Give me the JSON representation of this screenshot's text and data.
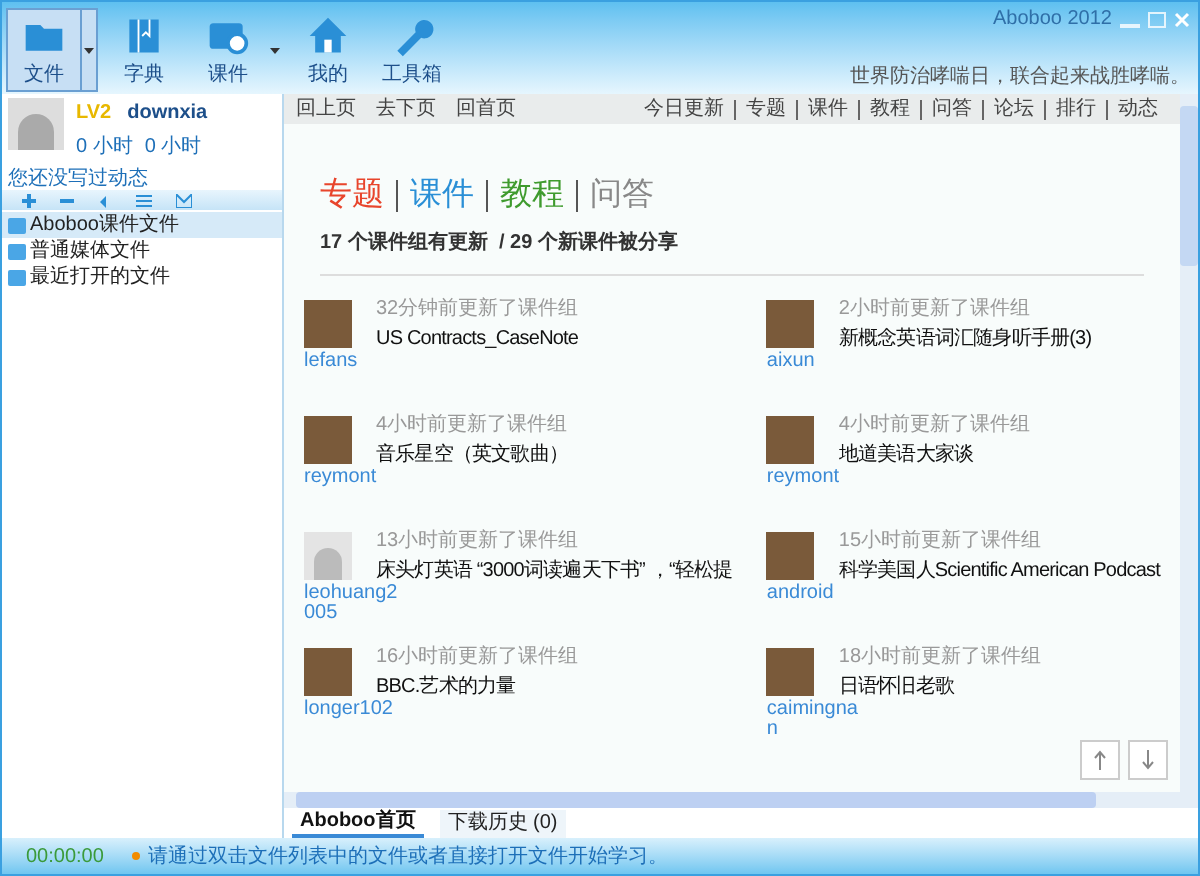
{
  "window": {
    "title": "Aboboo 2012"
  },
  "toolbar": [
    {
      "label": "文件",
      "selected": true,
      "dropdown": true,
      "kind": "folder"
    },
    {
      "label": "字典",
      "selected": false,
      "dropdown": false,
      "kind": "book"
    },
    {
      "label": "课件",
      "selected": false,
      "dropdown": true,
      "kind": "disc"
    },
    {
      "label": "我的",
      "selected": false,
      "dropdown": false,
      "kind": "home"
    },
    {
      "label": "工具箱",
      "selected": false,
      "dropdown": false,
      "kind": "wrench"
    }
  ],
  "notice": "世界防治哮喘日，联合起来战胜哮喘。",
  "user": {
    "level": "LV2",
    "name": "downxia",
    "listen_time": "0 小时",
    "speak_time": "0 小时",
    "status": "您还没写过动态"
  },
  "file_tree": [
    {
      "label": "Aboboo课件文件",
      "selected": true
    },
    {
      "label": "普通媒体文件",
      "selected": false
    },
    {
      "label": "最近打开的文件",
      "selected": false
    }
  ],
  "nav": {
    "history": [
      "回上页",
      "去下页",
      "回首页"
    ],
    "links": [
      "今日更新",
      "专题",
      "课件",
      "教程",
      "问答",
      "论坛",
      "排行",
      "动态"
    ]
  },
  "heading": [
    {
      "label": "专题",
      "color": "#e8452c"
    },
    {
      "label": "课件",
      "color": "#2a8fd6"
    },
    {
      "label": "教程",
      "color": "#3f9b2e"
    },
    {
      "label": "问答",
      "color": "#888888"
    }
  ],
  "summary": "17 个课件组有更新  / 29 个新课件被分享",
  "updates": [
    {
      "user": "lefans",
      "time": "32分钟前更新了课件组",
      "title": "US Contracts_CaseNote",
      "kind": "photo"
    },
    {
      "user": "aixun",
      "time": "2小时前更新了课件组",
      "title": "新概念英语词汇随身听手册(3)",
      "kind": "photo"
    },
    {
      "user": "reymont",
      "time": "4小时前更新了课件组",
      "title": "音乐星空（英文歌曲）",
      "kind": "photo"
    },
    {
      "user": "reymont",
      "time": "4小时前更新了课件组",
      "title": "地道美语大家谈",
      "kind": "photo"
    },
    {
      "user": "leohuang2005",
      "time": "13小时前更新了课件组",
      "title": "床头灯英语 “3000词读遍天下书” ，“轻松提",
      "kind": "default"
    },
    {
      "user": "android",
      "time": "15小时前更新了课件组",
      "title": "科学美国人Scientific American Podcast",
      "kind": "photo"
    },
    {
      "user": "longer102",
      "time": "16小时前更新了课件组",
      "title": "BBC.艺术的力量",
      "kind": "photo"
    },
    {
      "user": "caimingnan",
      "time": "18小时前更新了课件组",
      "title": "日语怀旧老歌",
      "kind": "photo"
    }
  ],
  "bottom_tabs": [
    {
      "label": "Aboboo首页",
      "selected": true
    },
    {
      "label": "下载历史 (0)",
      "selected": false
    }
  ],
  "status_bar": {
    "time": "00:00:00",
    "message": "请通过双击文件列表中的文件或者直接打开文件开始学习。"
  }
}
